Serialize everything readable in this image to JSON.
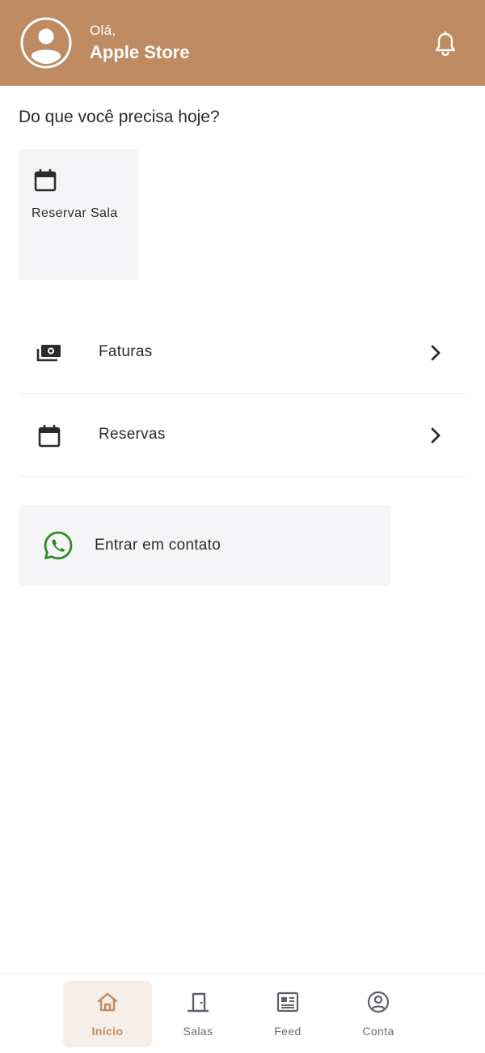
{
  "header": {
    "greeting": "Olá,",
    "store_name": "Apple Store",
    "avatar_icon": "user-avatar-icon",
    "notification_icon": "bell-icon"
  },
  "main": {
    "question": "Do que você precisa hoje?",
    "quick_actions": [
      {
        "label": "Reservar Sala",
        "icon": "calendar-icon"
      }
    ],
    "menu": [
      {
        "label": "Faturas",
        "icon": "money-icon"
      },
      {
        "label": "Reservas",
        "icon": "calendar-icon"
      }
    ],
    "contact": {
      "label": "Entrar em contato",
      "icon": "whatsapp-icon"
    }
  },
  "bottom_nav": {
    "items": [
      {
        "label": "Início",
        "icon": "home-icon",
        "active": true
      },
      {
        "label": "Salas",
        "icon": "door-icon",
        "active": false
      },
      {
        "label": "Feed",
        "icon": "newspaper-icon",
        "active": false
      },
      {
        "label": "Conta",
        "icon": "account-icon",
        "active": false
      }
    ]
  },
  "colors": {
    "brand": "#BE8B62",
    "card_background": "#F5F5F7",
    "active_nav_background": "#F6EEE7",
    "whatsapp_green": "#2E8B24",
    "text": "#2B2B2B",
    "inactive": "#6B6B6B"
  }
}
